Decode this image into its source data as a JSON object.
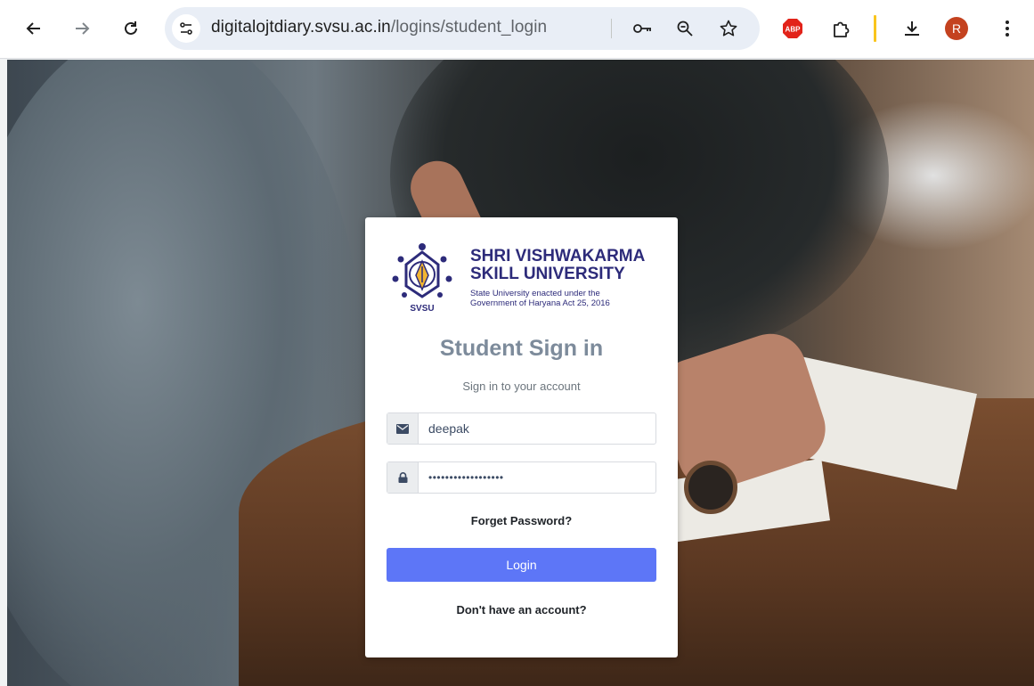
{
  "browser": {
    "url_host": "digitalojtdiary.svsu.ac.in",
    "url_path": "/logins/student_login",
    "back_icon": "arrow-left-icon",
    "forward_icon": "arrow-right-icon",
    "reload_icon": "reload-icon",
    "adblock_label": "ABP",
    "profile_initial": "R",
    "colors": {
      "toolbar": "#ffffff",
      "omnibox": "#e9eef6",
      "adblock": "#e2231a",
      "profile": "#c4421f"
    }
  },
  "logo": {
    "name_line1": "SHRI VISHWAKARMA",
    "name_line2": "SKILL UNIVERSITY",
    "sub_line1": "State University enacted under the",
    "sub_line2": "Government of Haryana Act 25, 2016",
    "abbr": "SVSU",
    "color": "#2d2b7a"
  },
  "login": {
    "title": "Student Sign in",
    "subtitle": "Sign in to your account",
    "username_value": "deepak",
    "password_value": "••••••••••••••••••",
    "forget_password": "Forget Password?",
    "login_button": "Login",
    "signup_link": "Don't have an account?",
    "button_color": "#5d76f7",
    "title_color": "#7d8b9b"
  }
}
